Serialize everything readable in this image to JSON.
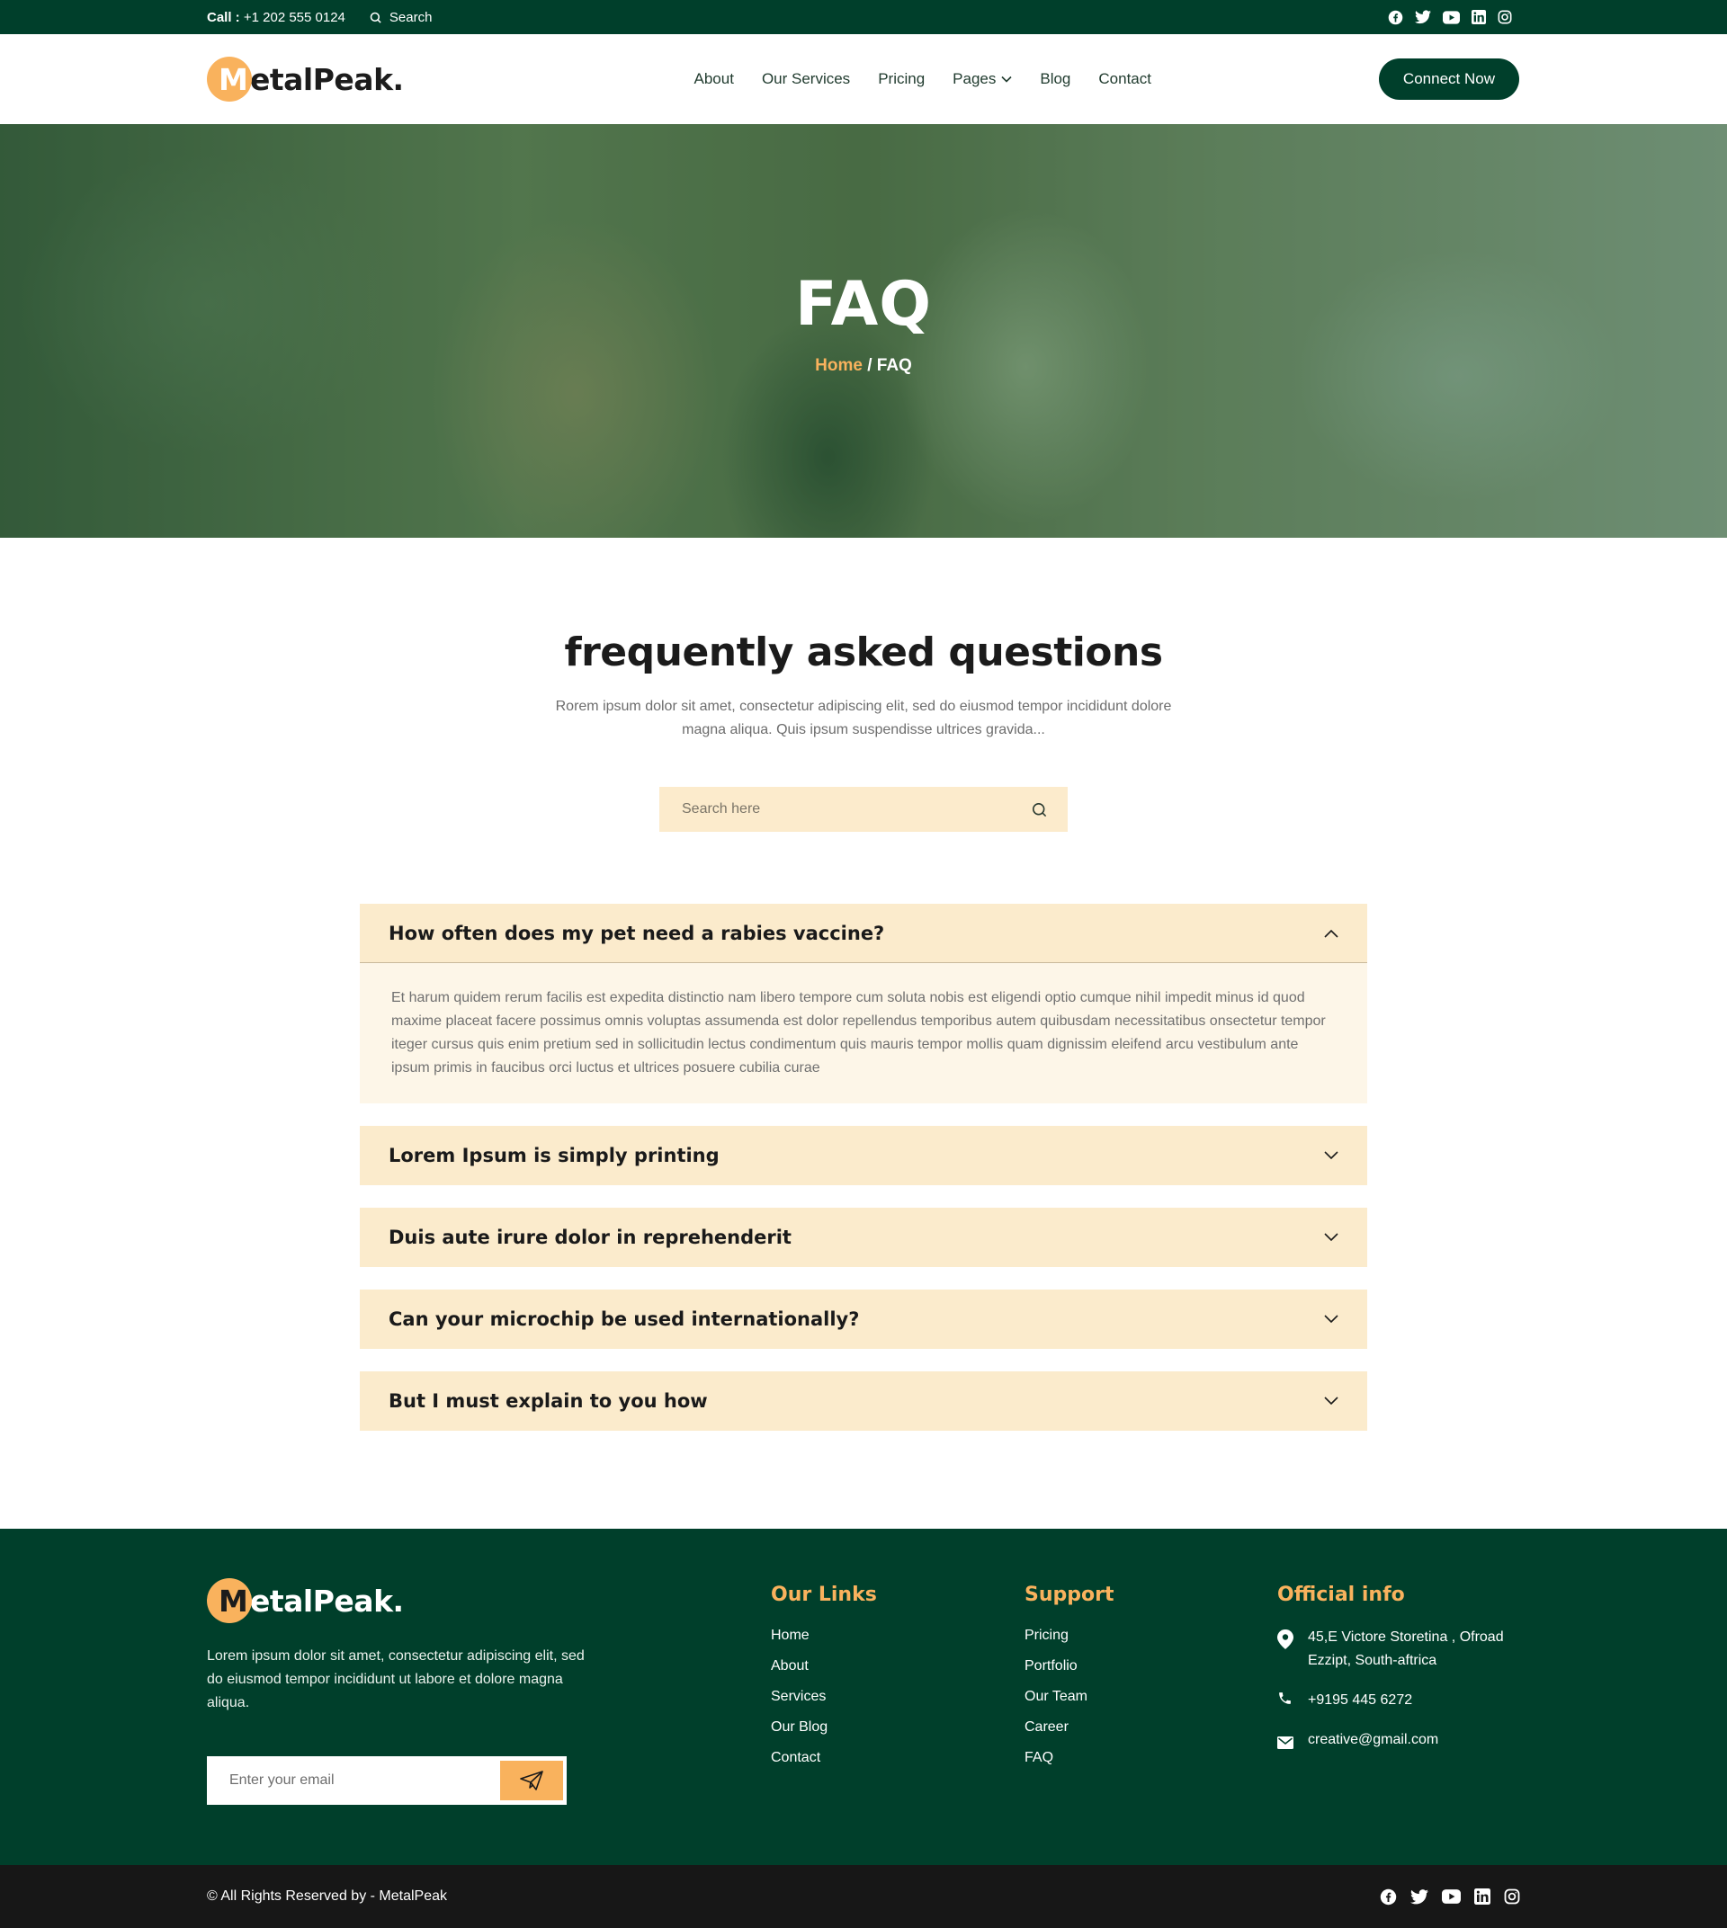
{
  "topbar": {
    "call_label": "Call :",
    "phone": "+1 202 555 0124",
    "search_label": "Search",
    "social": [
      "facebook-icon",
      "twitter-icon",
      "youtube-icon",
      "linkedin-icon",
      "instagram-icon"
    ]
  },
  "header": {
    "logo_initial": "M",
    "logo_rest": "etalPeak.",
    "nav": [
      "About",
      "Our Services",
      "Pricing",
      "Pages",
      "Blog",
      "Contact"
    ],
    "cta": "Connect Now"
  },
  "hero": {
    "title": "FAQ",
    "breadcrumb_home": "Home",
    "breadcrumb_sep": " / ",
    "breadcrumb_current": "FAQ"
  },
  "faq": {
    "heading": "frequently asked questions",
    "subtext": "Rorem ipsum dolor sit amet, consectetur adipiscing elit, sed do eiusmod tempor incididunt dolore magna aliqua. Quis ipsum suspendisse ultrices gravida...",
    "search_placeholder": "Search here",
    "items": [
      {
        "question": "How often does my pet need a rabies vaccine?",
        "answer": "Et harum quidem rerum facilis est expedita distinctio nam libero tempore cum soluta nobis est eligendi optio cumque nihil impedit minus id quod maxime placeat facere possimus omnis voluptas assumenda est dolor repellendus temporibus autem quibusdam necessitatibus onsectetur tempor iteger cursus quis enim pretium sed in sollicitudin lectus condimentum quis mauris tempor mollis quam dignissim eleifend arcu vestibulum ante ipsum primis in faucibus orci luctus et ultrices posuere cubilia curae",
        "open": true
      },
      {
        "question": "Lorem Ipsum is simply printing",
        "open": false
      },
      {
        "question": "Duis aute irure dolor in reprehenderit",
        "open": false
      },
      {
        "question": "Can your microchip be used internationally?",
        "open": false
      },
      {
        "question": "But I must explain to you how",
        "open": false
      }
    ]
  },
  "footer": {
    "logo_initial": "M",
    "logo_rest": "etalPeak.",
    "about": "Lorem ipsum dolor sit amet, consectetur adipiscing elit, sed do eiusmod tempor incididunt ut labore et dolore magna aliqua.",
    "email_placeholder": "Enter your email",
    "links_title": "Our Links",
    "links": [
      "Home",
      "About",
      "Services",
      "Our Blog",
      "Contact"
    ],
    "support_title": "Support",
    "support": [
      "Pricing",
      "Portfolio",
      "Our Team",
      "Career",
      "FAQ"
    ],
    "info_title": "Official info",
    "address": "45,E Victore Storetina , Ofroad Ezzipt, South-aftrica",
    "phone": "+9195 445 6272",
    "email": "creative@gmail.com",
    "copyright": "© All Rights Reserved by - MetalPeak"
  },
  "colors": {
    "primary_green": "#003f2b",
    "accent_orange": "#f9b25d",
    "accordion_bg": "#fbebcc",
    "footer_bottom": "#171717"
  }
}
